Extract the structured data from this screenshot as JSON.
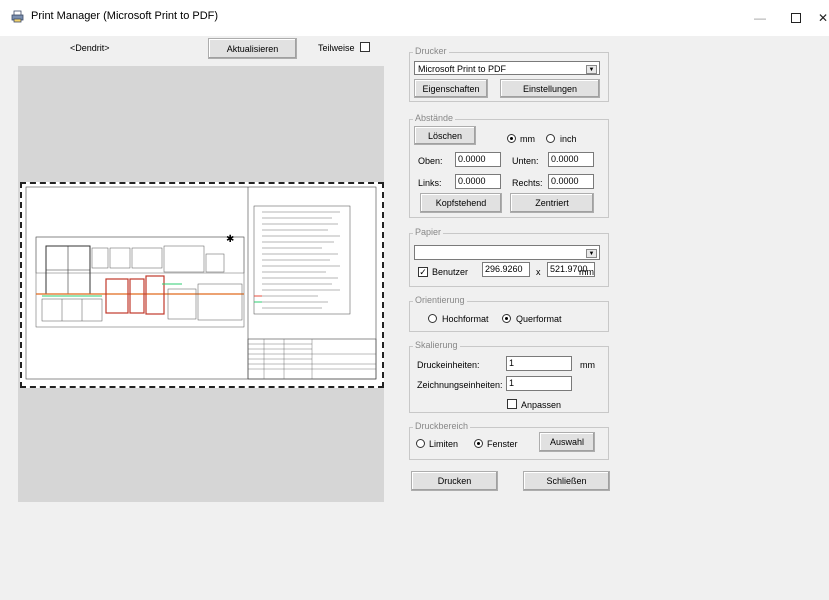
{
  "window": {
    "title": "Print Manager (Microsoft Print to PDF)",
    "minimize": "—",
    "close": "✕"
  },
  "toolbar": {
    "layer_label": "<Dendrit>",
    "refresh_button": "Aktualisieren",
    "partial_label": "Teilweise"
  },
  "printer": {
    "group_label": "Drucker",
    "selected": "Microsoft Print to PDF",
    "properties_button": "Eigenschaften",
    "settings_button": "Einstellungen"
  },
  "margins": {
    "group_label": "Abstände",
    "clear_button": "Löschen",
    "unit_mm": "mm",
    "unit_inch": "inch",
    "selected_unit": "mm",
    "top_label": "Oben:",
    "top_value": "0.0000",
    "bottom_label": "Unten:",
    "bottom_value": "0.0000",
    "left_label": "Links:",
    "left_value": "0.0000",
    "right_label": "Rechts:",
    "right_value": "0.0000",
    "upside_down_button": "Kopfstehend",
    "center_button": "Zentriert"
  },
  "paper": {
    "group_label": "Papier",
    "selected": "",
    "custom_label": "Benutzer",
    "custom_checked": true,
    "width": "296.9260",
    "times": "x",
    "height": "521.9700",
    "unit": "mm"
  },
  "orientation": {
    "group_label": "Orientierung",
    "portrait": "Hochformat",
    "landscape": "Querformat",
    "selected": "Querformat"
  },
  "scaling": {
    "group_label": "Skalierung",
    "print_units_label": "Druckeinheiten:",
    "print_units_value": "1",
    "unit": "mm",
    "drawing_units_label": "Zeichnungseinheiten:",
    "drawing_units_value": "1",
    "fit_label": "Anpassen",
    "fit_checked": false
  },
  "print_area": {
    "group_label": "Druckbereich",
    "limits": "Limiten",
    "window": "Fenster",
    "selected": "Fenster",
    "selection_button": "Auswahl"
  },
  "actions": {
    "print_button": "Drucken",
    "close_button": "Schließen"
  }
}
